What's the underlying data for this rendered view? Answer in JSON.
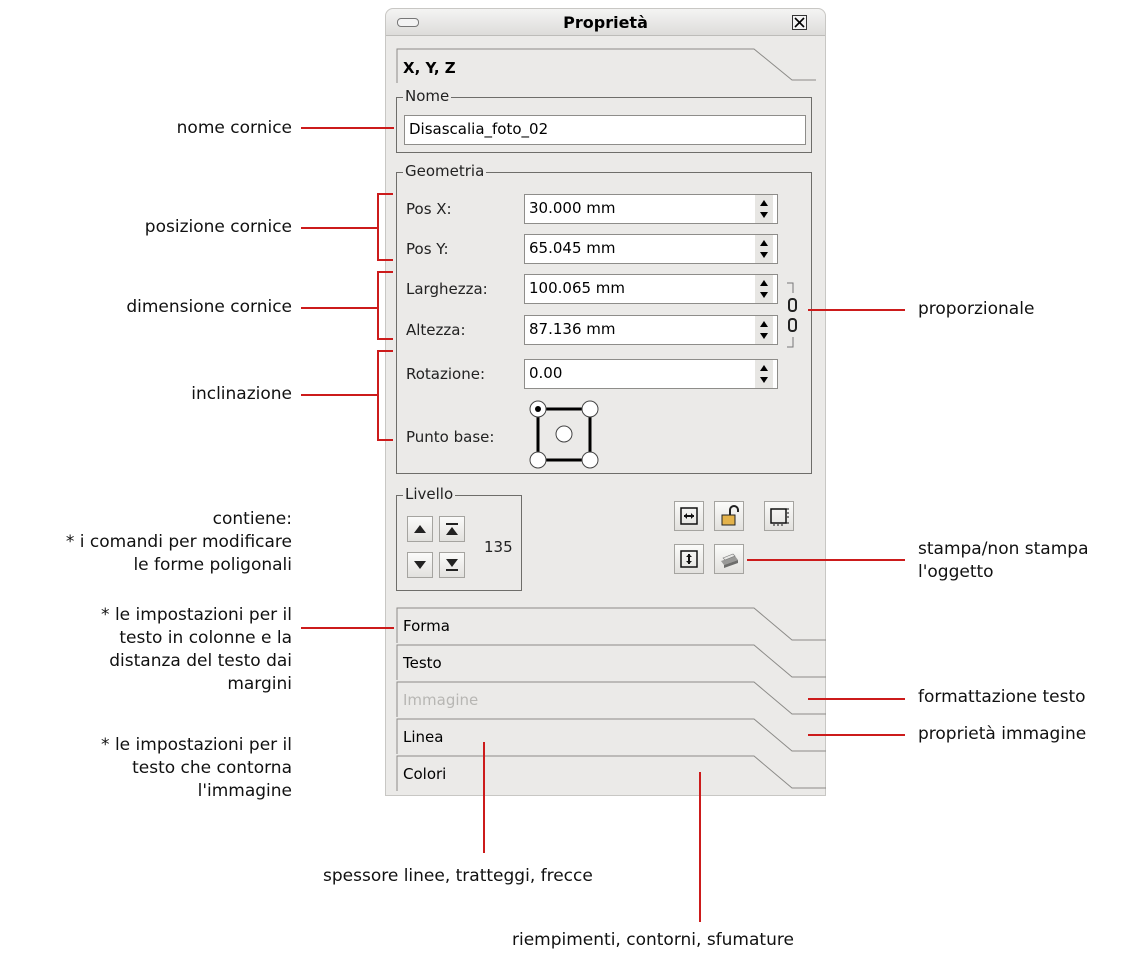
{
  "window": {
    "title": "Proprietà"
  },
  "tabs": {
    "xyz": "X, Y, Z",
    "forma": "Forma",
    "testo": "Testo",
    "immagine": "Immagine",
    "linea": "Linea",
    "colori": "Colori"
  },
  "nome": {
    "legend": "Nome",
    "value": "Disascalia_foto_02"
  },
  "geometria": {
    "legend": "Geometria",
    "pos_x_label": "Pos X:",
    "pos_x_value": "30.000 mm",
    "pos_y_label": "Pos Y:",
    "pos_y_value": "65.045 mm",
    "larghezza_label": "Larghezza:",
    "larghezza_value": "100.065 mm",
    "altezza_label": "Altezza:",
    "altezza_value": "87.136 mm",
    "rotazione_label": "Rotazione:",
    "rotazione_value": "0.00",
    "punto_base_label": "Punto base:"
  },
  "livello": {
    "legend": "Livello",
    "value": "135"
  },
  "annotations": {
    "nome_cornice": "nome cornice",
    "posizione_cornice": "posizione cornice",
    "dimensione_cornice": "dimensione cornice",
    "inclinazione": "inclinazione",
    "forma_1": "contiene:",
    "forma_2": "* i comandi per modificare",
    "forma_3": "le forme poligonali",
    "testo_1": "* le impostazioni per il",
    "testo_2": "testo in colonne e la",
    "testo_3": "distanza del testo dai",
    "testo_4": "margini",
    "immagine_1": "* le impostazioni per il",
    "immagine_2": "testo che contorna",
    "immagine_3": "l'immagine",
    "proporzionale": "proporzionale",
    "stampa_1": "stampa/non stampa",
    "stampa_2": "l'oggetto",
    "formattazione_testo": "formattazione testo",
    "proprieta_immagine": "proprietà immagine",
    "linea": "spessore linee, tratteggi, frecce",
    "colori": "riempimenti, contorni, sfumature"
  },
  "colors": {
    "annotation_line": "#cc1b1b",
    "panel_bg": "#ebeae8"
  }
}
